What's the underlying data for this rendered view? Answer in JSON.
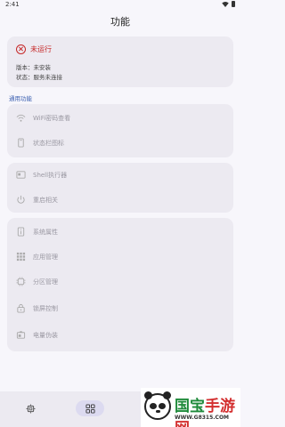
{
  "status_bar": {
    "time": "2:41",
    "icons": [
      "wifi-icon",
      "battery-icon"
    ]
  },
  "app_bar": {
    "title": "功能"
  },
  "status_card": {
    "title": "未运行",
    "version_line": "版本：未安装",
    "state_line": "状态：服务未连接",
    "accent_color": "#c62828"
  },
  "section": {
    "label": "通用功能"
  },
  "group_a": [
    {
      "label": "WiFi密码查看",
      "icon": "wifi-icon"
    },
    {
      "label": "状态栏图标",
      "icon": "phone-icon"
    }
  ],
  "group_b": [
    {
      "label": "Shell执行器",
      "icon": "terminal-icon"
    },
    {
      "label": "重启相关",
      "icon": "power-icon"
    }
  ],
  "group_c": [
    {
      "label": "系统属性",
      "icon": "info-icon"
    },
    {
      "label": "应用管理",
      "icon": "apps-grid-icon"
    },
    {
      "label": "分区管理",
      "icon": "chip-icon"
    },
    {
      "label": "锁屏控制",
      "icon": "lock-icon"
    },
    {
      "label": "电量伪装",
      "icon": "battery-icon"
    }
  ],
  "bottom_nav": {
    "items": [
      {
        "icon": "home-chip-icon",
        "selected": false
      },
      {
        "icon": "grid-icon",
        "selected": true
      }
    ]
  },
  "watermark": {
    "text_part1": "国宝",
    "text_part2": "手游网",
    "url": "WWW.G8315.COM"
  }
}
